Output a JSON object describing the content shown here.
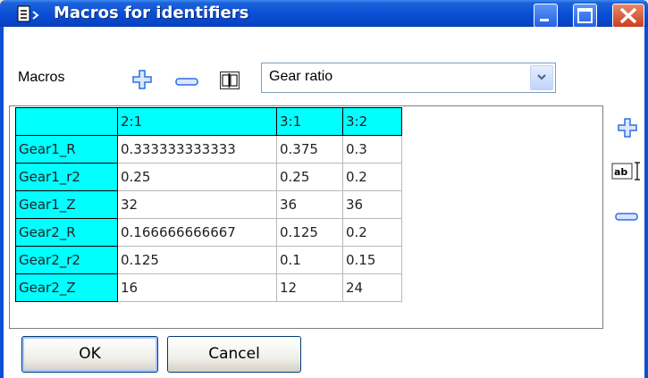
{
  "window": {
    "title": "Macros for identifiers"
  },
  "toolbar": {
    "macros_label": "Macros",
    "selected_macro": "Gear ratio",
    "icons": [
      "add-icon",
      "remove-icon",
      "rename-icon",
      "chevron-down-icon"
    ]
  },
  "grid": {
    "columns": [
      "2:1",
      "3:1",
      "3:2"
    ],
    "rows": [
      {
        "name": "Gear1_R",
        "values": [
          "0.333333333333",
          "0.375",
          "0.3"
        ]
      },
      {
        "name": "Gear1_r2",
        "values": [
          "0.25",
          "0.25",
          "0.2"
        ]
      },
      {
        "name": "Gear1_Z",
        "values": [
          "32",
          "36",
          "36"
        ]
      },
      {
        "name": "Gear2_R",
        "values": [
          "0.166666666667",
          "0.125",
          "0.2"
        ]
      },
      {
        "name": "Gear2_r2",
        "values": [
          "0.125",
          "0.1",
          "0.15"
        ]
      },
      {
        "name": "Gear2_Z",
        "values": [
          "16",
          "12",
          "24"
        ]
      }
    ]
  },
  "side": {
    "icons": [
      "add-column-icon",
      "edit-text-icon",
      "remove-column-icon"
    ]
  },
  "buttons": {
    "ok": "OK",
    "cancel": "Cancel"
  },
  "colors": {
    "header_fill": "#00ffff",
    "titlebar": "#0a4fd6",
    "icon_blue": "#2f6fe0"
  }
}
